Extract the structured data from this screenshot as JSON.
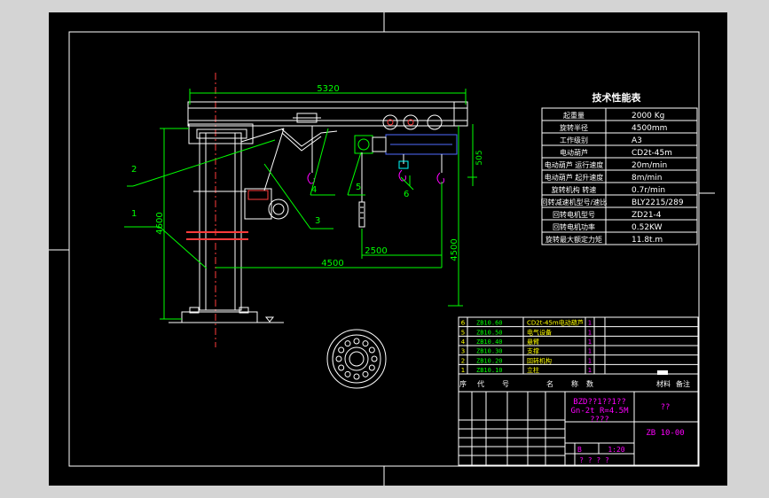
{
  "colors": {
    "frame_bg": "#d4d4d4",
    "paper": "#000000",
    "line": "#ffffff",
    "accent_green": "#00ff00",
    "accent_cyan": "#00ffff",
    "accent_red": "#ff0000",
    "accent_magenta": "#ff00ff",
    "accent_yellow": "#ffff00",
    "accent_blue": "#4f6bff"
  },
  "dimensions": {
    "top_span": "5320",
    "column_height": "4600",
    "hoist_height": "4500",
    "lower_offset": "505",
    "trolley_span": "2500",
    "rotation_radius": "4500"
  },
  "leaders": [
    "1",
    "2",
    "3",
    "4",
    "5",
    "6"
  ],
  "spec_table": {
    "title": "技术性能表",
    "rows": [
      {
        "label": "起重量",
        "value": "2000 Kg"
      },
      {
        "label": "旋转半径",
        "value": "4500mm"
      },
      {
        "label": "工作级别",
        "value": "A3"
      },
      {
        "label": "电动葫芦",
        "value": "CD2t-45m"
      },
      {
        "label": "电动葫芦 运行速度",
        "value": "20m/min"
      },
      {
        "label": "电动葫芦 起升速度",
        "value": "8m/min"
      },
      {
        "label": "旋转机构 转速",
        "value": "0.7r/min"
      },
      {
        "label": "回转减速机型号/速比",
        "value": "BLY2215/289"
      },
      {
        "label": "回转电机型号",
        "value": "ZD21-4"
      },
      {
        "label": "回转电机功率",
        "value": "0.52KW"
      },
      {
        "label": "旋转最大额定力矩",
        "value": "11.8t.m"
      }
    ]
  },
  "parts_list": [
    {
      "no": "6",
      "code": "ZB10.60",
      "name": "CD2t-45m电动葫芦",
      "qty": "1"
    },
    {
      "no": "5",
      "code": "ZB10.50",
      "name": "电气设备",
      "qty": "1"
    },
    {
      "no": "4",
      "code": "ZB10.40",
      "name": "悬臂",
      "qty": "1"
    },
    {
      "no": "3",
      "code": "ZB10.30",
      "name": "支撑",
      "qty": "1"
    },
    {
      "no": "2",
      "code": "ZB10.20",
      "name": "回转机构",
      "qty": "1"
    },
    {
      "no": "1",
      "code": "ZB10.10",
      "name": "立柱",
      "qty": "1"
    }
  ],
  "parts_header": [
    "序",
    "代",
    "号",
    "名",
    "称",
    "数",
    "材料",
    "备注"
  ],
  "title_block": {
    "title_line1": "BZD??1??1??",
    "title_line2": "Gn-2t  R=4.5M",
    "title_line3": "????",
    "school": "??",
    "drawing_no": "ZB 10-00",
    "scale_label": "B",
    "scale_value": "1:20",
    "sheets": "? ? ? ?"
  }
}
